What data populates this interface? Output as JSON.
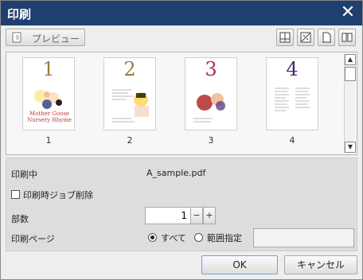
{
  "window": {
    "title": "印刷"
  },
  "toolbar": {
    "preview_label": "プレビュー"
  },
  "thumbnails": [
    {
      "label": "1",
      "page_number_text": "1",
      "accent": "#a07a3a",
      "title_lines": [
        "Mother Goose",
        "Nursery Rhyme"
      ]
    },
    {
      "label": "2",
      "page_number_text": "2",
      "accent": "#a07a3a"
    },
    {
      "label": "3",
      "page_number_text": "3",
      "accent": "#b02a52"
    },
    {
      "label": "4",
      "page_number_text": "4",
      "accent": "#4b2a78"
    }
  ],
  "scroll": {
    "up": "▲",
    "down": "▼"
  },
  "settings": {
    "printing_label": "印刷中",
    "file_name": "A_sample.pdf",
    "delete_job_label": "印刷時ジョブ削除",
    "copies_label": "部数",
    "copies_value": "1",
    "minus": "−",
    "plus": "+",
    "pages_label": "印刷ページ",
    "all_label": "すべて",
    "range_label": "範囲指定"
  },
  "buttons": {
    "ok": "OK",
    "cancel": "キャンセル"
  },
  "colors": {
    "titlebar": "#1f3f6f",
    "accent_ok_border": "#6aa3e6"
  }
}
